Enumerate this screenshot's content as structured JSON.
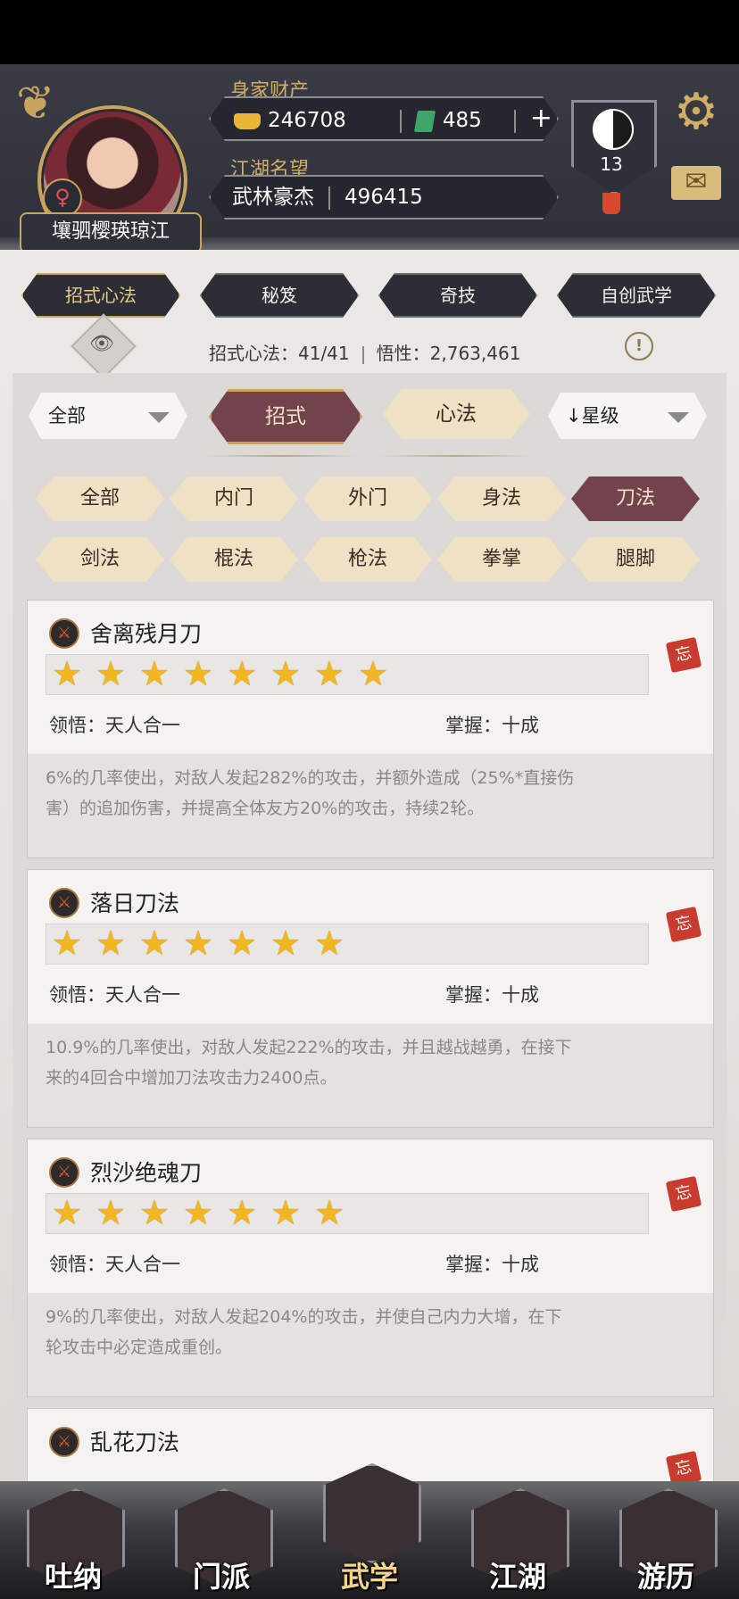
{
  "header": {
    "player_name": "壤驷樱瑛琼江",
    "wealth_label": "身家财产",
    "gold": "246708",
    "jade": "485",
    "add_symbol": "+",
    "reputation_label": "江湖名望",
    "reputation_title": "武林豪杰",
    "reputation_value": "496415",
    "sect_level": "13",
    "gender_symbol": "♀"
  },
  "tabs": [
    "招式心法",
    "秘笈",
    "奇技",
    "自创武学"
  ],
  "stats_line": {
    "count_label": "招式心法：41/41",
    "insight_label": "悟性：2,763,461"
  },
  "filters": {
    "left_dropdown": "全部",
    "segment_on": "招式",
    "segment_off": "心法",
    "sort_dropdown": "↓星级"
  },
  "categories": {
    "row1": [
      "全部",
      "内门",
      "外门",
      "身法",
      "刀法"
    ],
    "row2": [
      "剑法",
      "棍法",
      "枪法",
      "拳掌",
      "腿脚"
    ]
  },
  "skills": [
    {
      "name": "舍离残月刀",
      "stars": 8,
      "comprehension": "领悟：天人合一",
      "mastery": "掌握：十成",
      "desc_line1": "6%的几率使出，对敌人发起282%的攻击，并额外造成（25%*直接伤",
      "desc_line2": "害）的追加伤害，并提高全体友方20%的攻击，持续2轮。"
    },
    {
      "name": "落日刀法",
      "stars": 7,
      "comprehension": "领悟：天人合一",
      "mastery": "掌握：十成",
      "desc_line1": "10.9%的几率使出，对敌人发起222%的攻击，并且越战越勇，在接下",
      "desc_line2": "来的4回合中增加刀法攻击力2400点。"
    },
    {
      "name": "烈沙绝魂刀",
      "stars": 7,
      "comprehension": "领悟：天人合一",
      "mastery": "掌握：十成",
      "desc_line1": "9%的几率使出，对敌人发起204%的攻击，并使自己内力大增，在下",
      "desc_line2": "轮攻击中必定造成重创。"
    },
    {
      "name": "乱花刀法"
    }
  ],
  "forget_tag": "忘",
  "nav": [
    "吐纳",
    "门派",
    "武学",
    "江湖",
    "游历"
  ]
}
